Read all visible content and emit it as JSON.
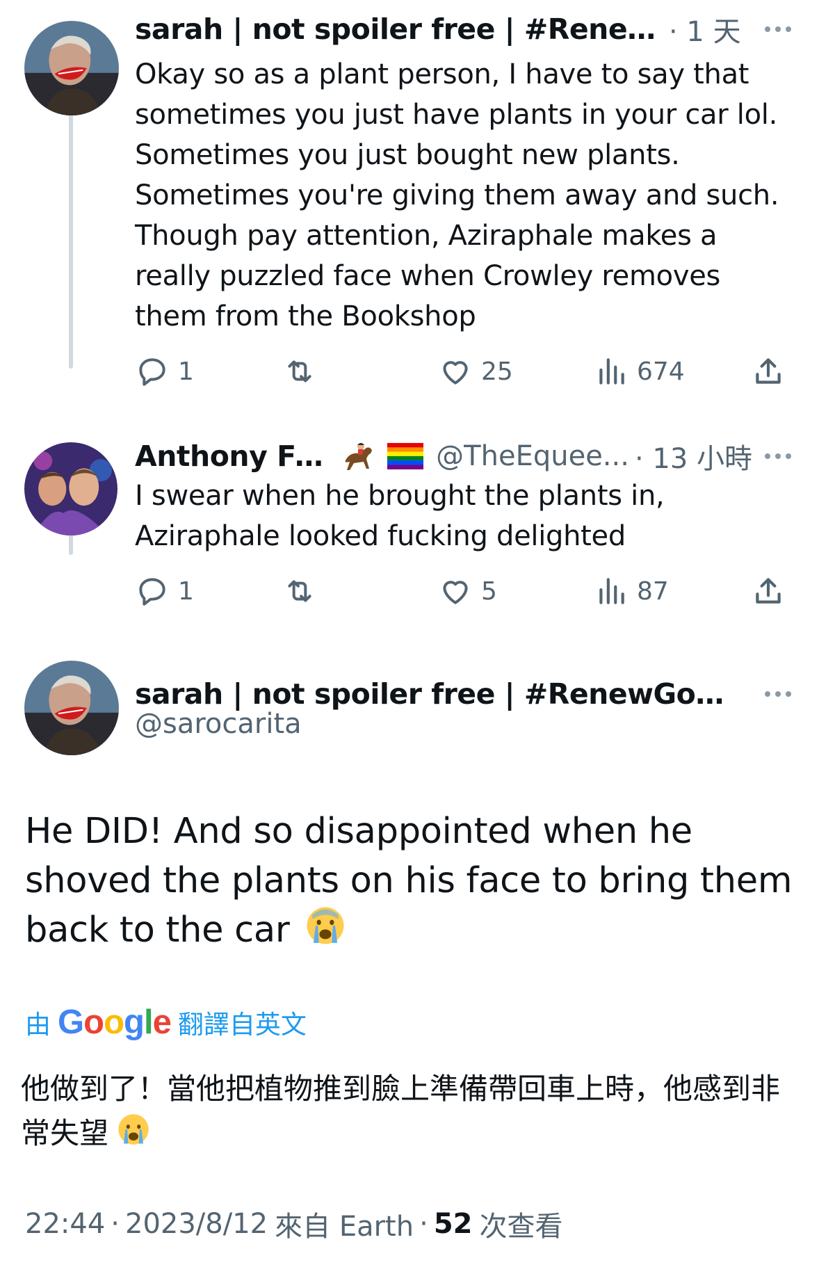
{
  "tweets": [
    {
      "name": "sarah | not spoiler free | #RenewGo...",
      "handle": "",
      "time": "· 1 天",
      "text": "Okay so as a plant person, I have to say that sometimes you just have plants in your car lol. Sometimes you just bought new plants. Sometimes you're giving them away and such. Though pay attention, Aziraphale makes a really puzzled face when Crowley removes them from the Bookshop",
      "replies": "1",
      "likes": "25",
      "views": "674"
    },
    {
      "name": "Anthony Fell",
      "handle": "@TheEquee...",
      "time": "· 13 小時",
      "text": "I swear when he brought the plants in, Aziraphale looked fucking delighted",
      "replies": "1",
      "likes": "5",
      "views": "87"
    }
  ],
  "main": {
    "name": "sarah | not spoiler free | #RenewGoodO...",
    "handle": "@sarocarita",
    "text": "He DID! And so disappointed when he shoved the plants on his face to bring them back to the car",
    "translate_by": "由",
    "translate_brand": "Google",
    "translate_label": "翻譯自英文",
    "translated_text": "他做到了！當他把植物推到臉上準備帶回車上時，他感到非常失望",
    "time": "22:44",
    "date": "2023/8/12",
    "source": "來自 Earth",
    "views_count": "52",
    "views_label": "次查看"
  },
  "icons": [
    "reply-icon",
    "retweet-icon",
    "like-icon",
    "views-icon",
    "share-icon",
    "more-icon",
    "horse-racing-emoji",
    "rainbow-flag-emoji",
    "crying-face-emoji"
  ],
  "colors": {
    "text": "#0f1419",
    "secondary": "#536471",
    "link": "#1d9bf0",
    "thread_line": "#cfd9de"
  }
}
